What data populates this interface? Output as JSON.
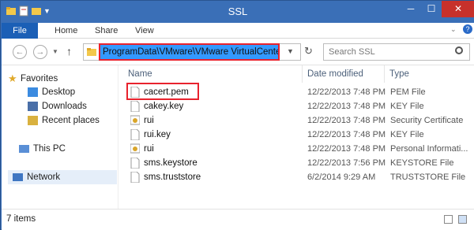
{
  "window": {
    "title": "SSL"
  },
  "ribbon": {
    "tabs": [
      "File",
      "Home",
      "Share",
      "View"
    ]
  },
  "address": {
    "path": "ProgramData\\VMware\\VMware VirtualCenter\\SSL",
    "search_placeholder": "Search SSL"
  },
  "nav": {
    "favorites": "Favorites",
    "items": [
      "Desktop",
      "Downloads",
      "Recent places"
    ],
    "this_pc": "This PC",
    "network": "Network"
  },
  "columns": {
    "name": "Name",
    "date": "Date modified",
    "type": "Type"
  },
  "files": [
    {
      "name": "cacert.pem",
      "date": "12/22/2013 7:48 PM",
      "type": "PEM File",
      "icon": "document-icon"
    },
    {
      "name": "cakey.key",
      "date": "12/22/2013 7:48 PM",
      "type": "KEY File",
      "icon": "document-icon"
    },
    {
      "name": "rui",
      "date": "12/22/2013 7:48 PM",
      "type": "Security Certificate",
      "icon": "certificate-icon"
    },
    {
      "name": "rui.key",
      "date": "12/22/2013 7:48 PM",
      "type": "KEY File",
      "icon": "document-icon"
    },
    {
      "name": "rui",
      "date": "12/22/2013 7:48 PM",
      "type": "Personal Informati...",
      "icon": "certificate-icon"
    },
    {
      "name": "sms.keystore",
      "date": "12/22/2013 7:56 PM",
      "type": "KEYSTORE File",
      "icon": "document-icon"
    },
    {
      "name": "sms.truststore",
      "date": "6/2/2014 9:29 AM",
      "type": "TRUSTSTORE File",
      "icon": "document-icon"
    }
  ],
  "status": {
    "count": "7 items"
  },
  "colors": {
    "titlebar": "#3a6fb7",
    "close": "#c7312b",
    "highlight": "#e8222d",
    "selection": "#3399ff"
  }
}
